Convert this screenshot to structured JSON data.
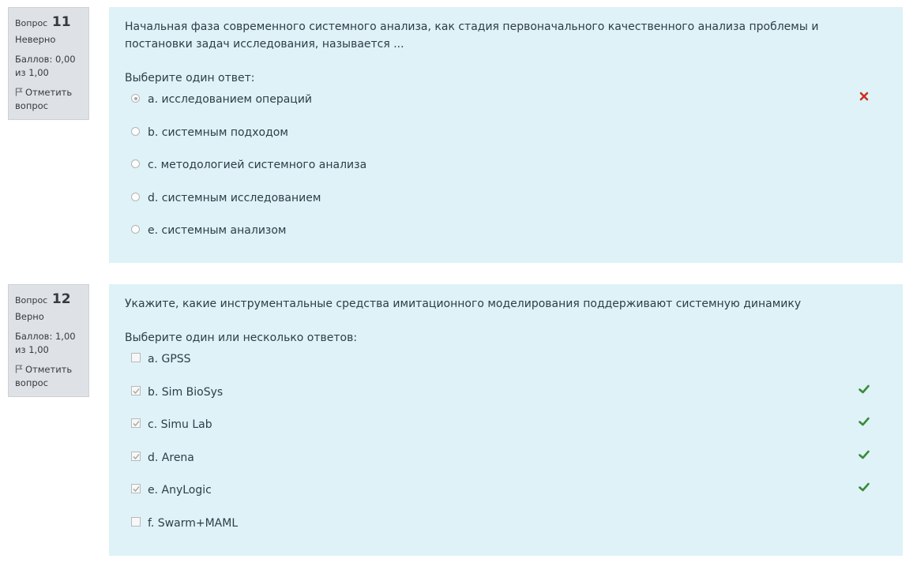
{
  "questions": [
    {
      "id": "q11",
      "word": "Вопрос",
      "number": "11",
      "state": "Неверно",
      "grade": "Баллов: 0,00 из 1,00",
      "flag_label": "Отметить вопрос",
      "text": "Начальная фаза современного системного анализа, как стадия первоначального качественного анализа проблемы и постановки задач исследования, называется ...",
      "prompt": "Выберите один ответ:",
      "type": "radio",
      "answers": [
        {
          "label": "a. исследованием операций",
          "checked": true,
          "mark": "incorrect"
        },
        {
          "label": "b. системным подходом",
          "checked": false,
          "mark": ""
        },
        {
          "label": "c. методологией системного анализа",
          "checked": false,
          "mark": ""
        },
        {
          "label": "d. системным исследованием",
          "checked": false,
          "mark": ""
        },
        {
          "label": "e. системным анализом",
          "checked": false,
          "mark": ""
        }
      ]
    },
    {
      "id": "q12",
      "word": "Вопрос",
      "number": "12",
      "state": "Верно",
      "grade": "Баллов: 1,00 из 1,00",
      "flag_label": "Отметить вопрос",
      "text": "Укажите, какие инструментальные средства имитационного моделирования поддерживают системную динамику",
      "prompt": "Выберите один или несколько ответов:",
      "type": "checkbox",
      "answers": [
        {
          "label": "a. GPSS",
          "checked": false,
          "mark": ""
        },
        {
          "label": "b. Sim BioSys",
          "checked": true,
          "mark": "correct"
        },
        {
          "label": "c. Simu Lab",
          "checked": true,
          "mark": "correct"
        },
        {
          "label": "d. Arena",
          "checked": true,
          "mark": "correct"
        },
        {
          "label": "e. AnyLogic",
          "checked": true,
          "mark": "correct"
        },
        {
          "label": "f. Swarm+MAML",
          "checked": false,
          "mark": ""
        }
      ]
    }
  ],
  "colors": {
    "info_bg": "#dee2e6",
    "content_bg": "#def2f8",
    "correct": "#3a8a3a",
    "incorrect": "#ca3120"
  },
  "icons": {
    "flag": "flag-icon",
    "correct": "check-icon",
    "incorrect": "cross-icon"
  }
}
